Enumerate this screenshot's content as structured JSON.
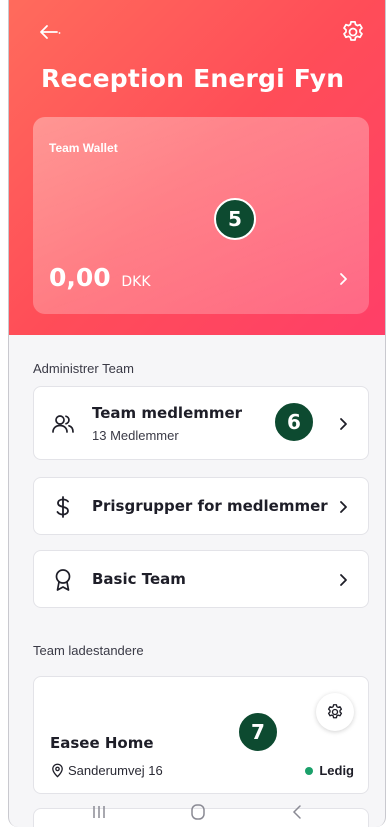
{
  "header": {
    "title": "Reception Energi Fyn"
  },
  "wallet": {
    "label": "Team Wallet",
    "amount": "0,00",
    "currency": "DKK"
  },
  "badges": {
    "wallet": "5",
    "members": "6",
    "charger": "7"
  },
  "manage_section": {
    "label": "Administrer Team",
    "items": [
      {
        "label": "Team medlemmer",
        "sub": "13 Medlemmer",
        "icon": "users-icon"
      },
      {
        "label": "Prisgrupper for medlemmer",
        "icon": "dollar-icon"
      },
      {
        "label": "Basic Team",
        "icon": "badge-ribbon-icon"
      }
    ]
  },
  "chargers_section": {
    "label": "Team ladestandere",
    "chargers": [
      {
        "name": "Easee Home",
        "address": "Sanderumvej 16",
        "status": "Ledig",
        "status_color": "#1aa06a"
      }
    ]
  },
  "colors": {
    "header_gradient_start": "#ff6b5c",
    "header_gradient_end": "#ff3f68",
    "badge_bg": "#0d4a30"
  }
}
